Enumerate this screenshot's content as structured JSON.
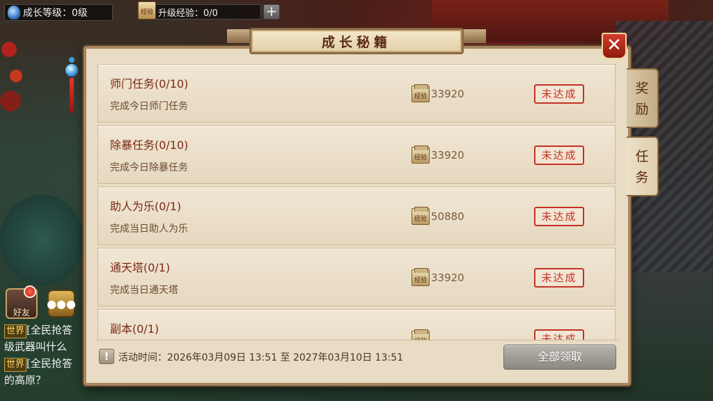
{
  "hud": {
    "level_label": "成长等级：0级",
    "exp_badge": "经验",
    "exp_label": "升级经验：0/0",
    "plus": "+"
  },
  "panel": {
    "title": "成长秘籍",
    "close": "✕",
    "tabs": [
      {
        "label": "奖励"
      },
      {
        "label": "任务"
      }
    ],
    "reward_icon_label": "经验",
    "tasks": [
      {
        "title": "师门任务(0/10)",
        "desc": "完成今日师门任务",
        "reward": "33920",
        "status": "未达成"
      },
      {
        "title": "除暴任务(0/10)",
        "desc": "完成今日除暴任务",
        "reward": "33920",
        "status": "未达成"
      },
      {
        "title": "助人为乐(0/1)",
        "desc": "完成当日助人为乐",
        "reward": "50880",
        "status": "未达成"
      },
      {
        "title": "通天塔(0/1)",
        "desc": "完成当日通天塔",
        "reward": "33920",
        "status": "未达成"
      },
      {
        "title": "副本(0/1)",
        "desc": "",
        "reward": "",
        "status": "未达成"
      }
    ],
    "activity_time": "活动时间：2026年03月09日 13:51 至 2027年03月10日 13:51",
    "info_icon": "!",
    "claim_all": "全部领取"
  },
  "left": {
    "friend_label": "好友",
    "chat": [
      {
        "channel": "世界",
        "text": "[全民抢答",
        "cont": "级武器叫什么"
      },
      {
        "channel": "世界",
        "text": "[全民抢答",
        "cont": "的高原？"
      }
    ]
  }
}
